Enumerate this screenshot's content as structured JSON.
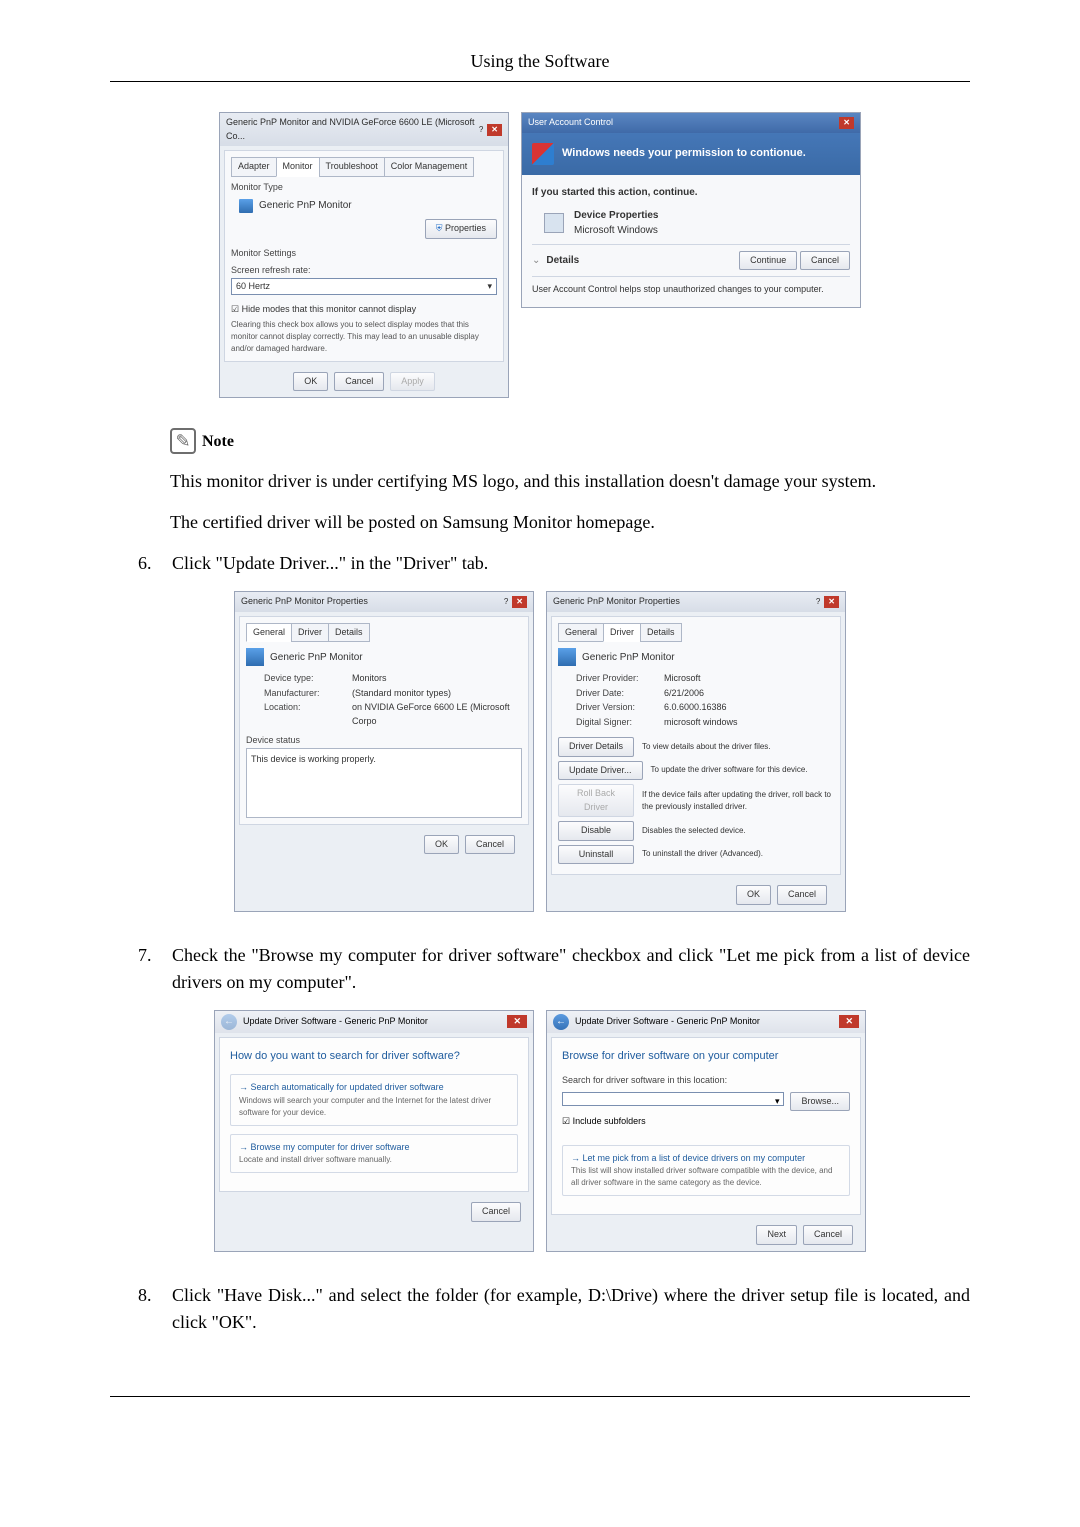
{
  "header": {
    "title": "Using the Software"
  },
  "figure1": {
    "monitorDialog": {
      "title": "Generic PnP Monitor and NVIDIA GeForce 6600 LE (Microsoft Co...",
      "tabs": [
        "Adapter",
        "Monitor",
        "Troubleshoot",
        "Color Management"
      ],
      "monitorTypeLabel": "Monitor Type",
      "monitorName": "Generic PnP Monitor",
      "propertiesBtn": "Properties",
      "monitorSettingsLabel": "Monitor Settings",
      "refreshLabel": "Screen refresh rate:",
      "refreshValue": "60 Hertz",
      "hideModesLabel": "Hide modes that this monitor cannot display",
      "hideModesDesc": "Clearing this check box allows you to select display modes that this monitor cannot display correctly. This may lead to an unusable display and/or damaged hardware.",
      "ok": "OK",
      "cancel": "Cancel",
      "apply": "Apply"
    },
    "uac": {
      "titlebar": "User Account Control",
      "headline": "Windows needs your permission to contionue.",
      "startedLine": "If you started this action, continue.",
      "propName": "Device Properties",
      "propVendor": "Microsoft Windows",
      "details": "Details",
      "continue": "Continue",
      "cancel": "Cancel",
      "footer": "User Account Control helps stop unauthorized changes to your computer."
    }
  },
  "note": {
    "label": "Note"
  },
  "para1": "This monitor driver is under certifying MS logo, and this installation doesn't damage your system.",
  "para2": "The certified driver will be posted on Samsung Monitor homepage.",
  "step6": {
    "num": "6.",
    "text": "Click \"Update Driver...\" in the \"Driver\" tab."
  },
  "figure2": {
    "propsTitle": "Generic PnP Monitor Properties",
    "tabs": [
      "General",
      "Driver",
      "Details"
    ],
    "monitorName": "Generic PnP Monitor",
    "general": {
      "deviceTypeLabel": "Device type:",
      "deviceType": "Monitors",
      "manufacturerLabel": "Manufacturer:",
      "manufacturer": "(Standard monitor types)",
      "locationLabel": "Location:",
      "location": "on NVIDIA GeForce 6600 LE (Microsoft Corpo",
      "statusLabel": "Device status",
      "statusText": "This device is working properly."
    },
    "driver": {
      "providerLabel": "Driver Provider:",
      "provider": "Microsoft",
      "dateLabel": "Driver Date:",
      "date": "6/21/2006",
      "versionLabel": "Driver Version:",
      "version": "6.0.6000.16386",
      "signerLabel": "Digital Signer:",
      "signer": "microsoft windows",
      "btnDetails": "Driver Details",
      "btnDetailsDesc": "To view details about the driver files.",
      "btnUpdate": "Update Driver...",
      "btnUpdateDesc": "To update the driver software for this device.",
      "btnRollback": "Roll Back Driver",
      "btnRollbackDesc": "If the device fails after updating the driver, roll back to the previously installed driver.",
      "btnDisable": "Disable",
      "btnDisableDesc": "Disables the selected device.",
      "btnUninstall": "Uninstall",
      "btnUninstallDesc": "To uninstall the driver (Advanced)."
    },
    "ok": "OK",
    "cancel": "Cancel"
  },
  "step7": {
    "num": "7.",
    "text": "Check the \"Browse my computer for driver software\" checkbox and click \"Let me pick from a list of device drivers on my computer\"."
  },
  "figure3": {
    "wizardTitle": "Update Driver Software - Generic PnP Monitor",
    "page1": {
      "heading": "How do you want to search for driver software?",
      "opt1Title": "Search automatically for updated driver software",
      "opt1Desc": "Windows will search your computer and the Internet for the latest driver software for your device.",
      "opt2Title": "Browse my computer for driver software",
      "opt2Desc": "Locate and install driver software manually."
    },
    "page2": {
      "heading": "Browse for driver software on your computer",
      "searchLabel": "Search for driver software in this location:",
      "browse": "Browse...",
      "includeSub": "Include subfolders",
      "opt1Title": "Let me pick from a list of device drivers on my computer",
      "opt1Desc": "This list will show installed driver software compatible with the device, and all driver software in the same category as the device."
    },
    "next": "Next",
    "cancel": "Cancel"
  },
  "step8": {
    "num": "8.",
    "text": "Click \"Have Disk...\" and select the folder (for example, D:\\Drive) where the driver setup file is located, and click \"OK\"."
  }
}
